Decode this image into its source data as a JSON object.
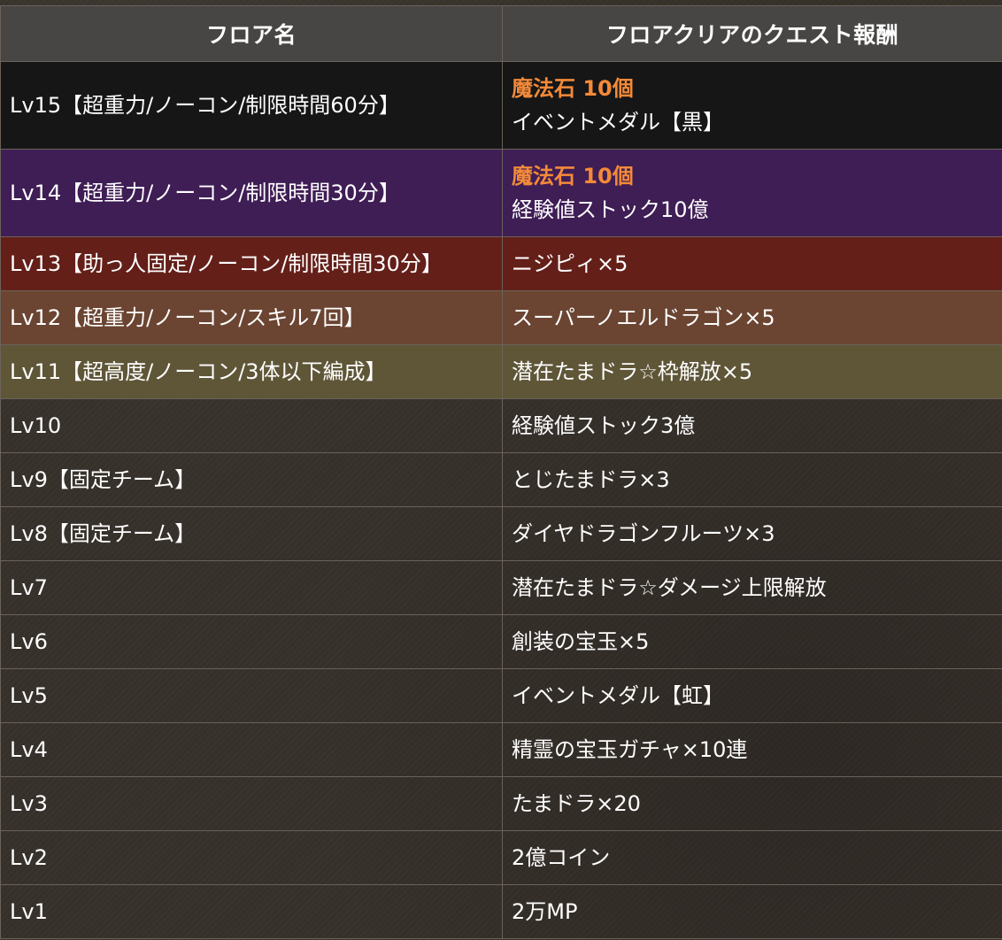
{
  "header": {
    "floor_name": "フロア名",
    "reward": "フロアクリアのクエスト報酬"
  },
  "rows": [
    {
      "floor": "Lv15【超重力/ノーコン/制限時間60分】",
      "highlight": "魔法石 10個",
      "reward": "イベントメダル【黒】"
    },
    {
      "floor": "Lv14【超重力/ノーコン/制限時間30分】",
      "highlight": "魔法石 10個",
      "reward": "経験値ストック10億"
    },
    {
      "floor": "Lv13【助っ人固定/ノーコン/制限時間30分】",
      "reward": "ニジピィ×5"
    },
    {
      "floor": "Lv12【超重力/ノーコン/スキル7回】",
      "reward": "スーパーノエルドラゴン×5"
    },
    {
      "floor": "Lv11【超高度/ノーコン/3体以下編成】",
      "reward": "潜在たまドラ☆枠解放×5"
    },
    {
      "floor": "Lv10",
      "reward": "経験値ストック3億"
    },
    {
      "floor": "Lv9【固定チーム】",
      "reward": "とじたまドラ×3"
    },
    {
      "floor": "Lv8【固定チーム】",
      "reward": "ダイヤドラゴンフルーツ×3"
    },
    {
      "floor": "Lv7",
      "reward": "潜在たまドラ☆ダメージ上限解放"
    },
    {
      "floor": "Lv6",
      "reward": "創装の宝玉×5"
    },
    {
      "floor": "Lv5",
      "reward": "イベントメダル【虹】"
    },
    {
      "floor": "Lv4",
      "reward": "精霊の宝玉ガチャ×10連"
    },
    {
      "floor": "Lv3",
      "reward": "たまドラ×20"
    },
    {
      "floor": "Lv2",
      "reward": "2億コイン"
    },
    {
      "floor": "Lv1",
      "reward": "2万MP"
    }
  ],
  "colors": {
    "lv15_row": "#161616",
    "lv14_row": "#3f1d55",
    "lv13_row": "#641f19",
    "lv12_row": "#6b4532",
    "lv11_row": "#5f5638",
    "highlight_text": "#f38a39",
    "header_bg": "#474644"
  }
}
